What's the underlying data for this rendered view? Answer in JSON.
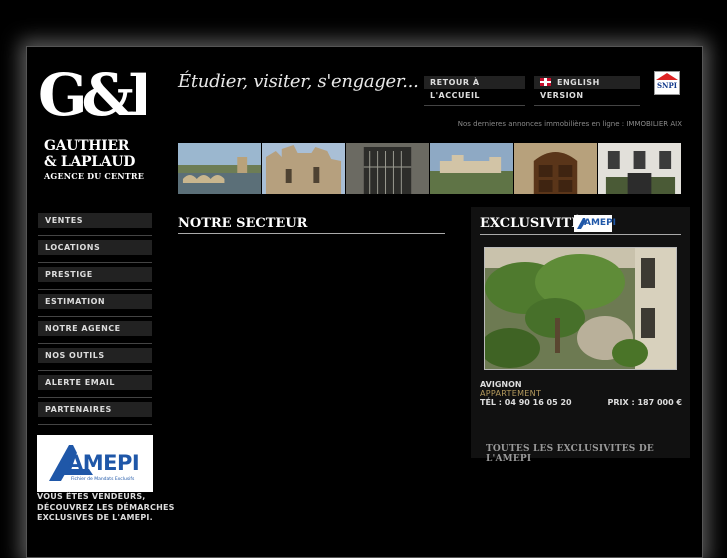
{
  "header": {
    "monogram": "G&L",
    "brand_line1": "GAUTHIER",
    "brand_line2": "& LAPLAUD",
    "brand_line3": "AGENCE DU CENTRE",
    "tagline": "Étudier, visiter, s'engager...",
    "home_button": "RETOUR À L'ACCUEIL",
    "english_button": "ENGLISH VERSION",
    "snpi_badge": "SNPI",
    "annonces_text": "Nos dernieres annonces immobilières en ligne : IMMOBILIER AIX"
  },
  "nav": {
    "items": [
      "VENTES",
      "LOCATIONS",
      "PRESTIGE",
      "ESTIMATION",
      "NOTRE AGENCE",
      "NOS OUTILS",
      "ALERTE EMAIL",
      "PARTENAIRES"
    ]
  },
  "amepi": {
    "logo_text": "AMEPI",
    "logo_subtext": "Fichier de Mandats Exclusifs",
    "vendeurs_text": "VOUS ÊTES VENDEURS, DÉCOUVREZ LES DÉMARCHES EXCLUSIVES DE L'AMEPI."
  },
  "main": {
    "section_title": "NOTRE SECTEUR"
  },
  "exclusivites": {
    "title": "EXCLUSIVITÉS",
    "badge": "AMEPI",
    "ville": "AVIGNON",
    "type": "APPARTEMENT",
    "tel": "TÉL : 04 90 16 05 20",
    "prix": "PRIX : 187 000 €",
    "toutes_link": "TOUTES LES EXCLUSIVITES DE L'AMEPI"
  },
  "colors": {
    "background": "#000000",
    "button_bg": "#222222",
    "accent_gold": "#b59b5e",
    "amepi_blue": "#1f57a8"
  }
}
